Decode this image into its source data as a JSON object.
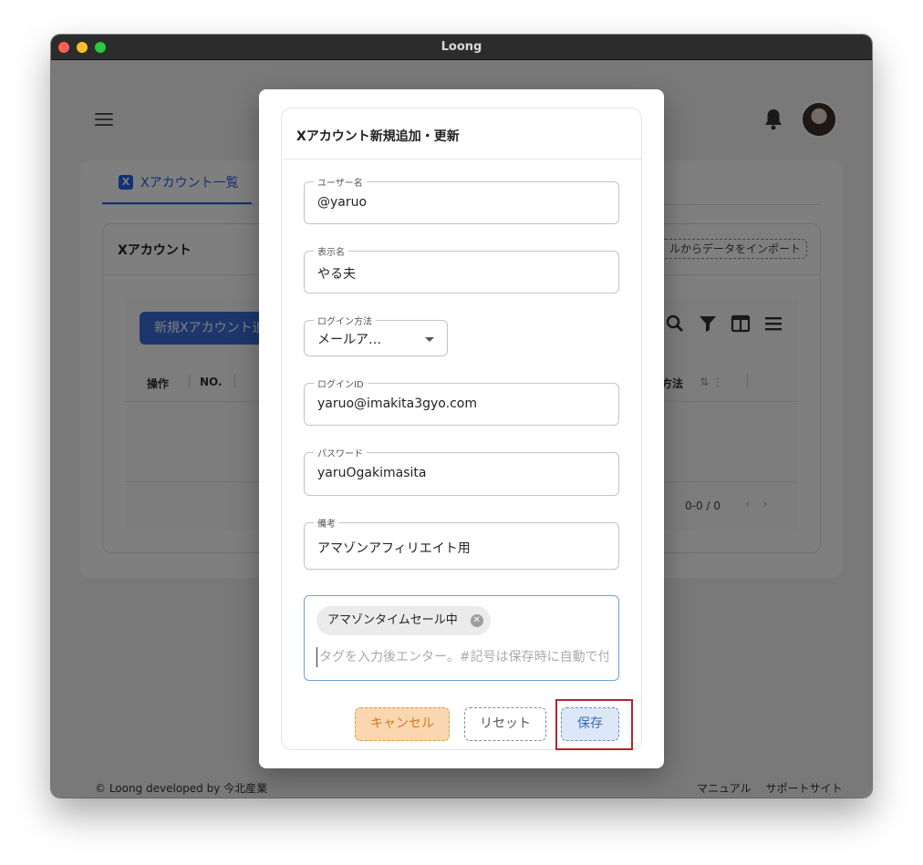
{
  "window": {
    "title": "Loong"
  },
  "header": {
    "menu_icon": "hamburger-icon",
    "bell_icon": "bell-icon",
    "avatar": "avatar"
  },
  "tabs": [
    {
      "label": "Xアカウント一覧",
      "icon": "x-logo-icon",
      "active": true
    }
  ],
  "card": {
    "title": "Xアカウント",
    "import_button": "ルからデータをインポート",
    "new_button": "新規Xアカウント追",
    "toolbar_icons": [
      "search-icon",
      "filter-icon",
      "columns-icon",
      "density-icon"
    ],
    "columns": [
      "操作",
      "NO.",
      "ン方法"
    ],
    "pagination": "0-0 / 0"
  },
  "footer": {
    "copyright": "© Loong developed by 今北産業",
    "links": [
      "マニュアル",
      "サポートサイト"
    ]
  },
  "dialog": {
    "title": "Xアカウント新規追加・更新",
    "fields": [
      {
        "label": "ユーザー名",
        "value": "@yaruo"
      },
      {
        "label": "表示名",
        "value": "やる夫"
      },
      {
        "label": "ログイン方法",
        "value": "メールア…",
        "type": "select"
      },
      {
        "label": "ログインID",
        "value": "yaruo@imakita3gyo.com"
      },
      {
        "label": "パスワード",
        "value": "yaruOgakimasita"
      },
      {
        "label": "備考",
        "value": "アマゾンアフィリエイト用"
      }
    ],
    "tags": {
      "chips": [
        "アマゾンタイムセール中"
      ],
      "placeholder": "タグを入力後エンター。#記号は保存時に自動で付加"
    },
    "buttons": {
      "cancel": "キャンセル",
      "reset": "リセット",
      "save": "保存"
    }
  },
  "colors": {
    "accent": "#2563eb",
    "cancel": "#fad7b0",
    "save": "#dce8f8",
    "highlight": "#b3262e"
  }
}
